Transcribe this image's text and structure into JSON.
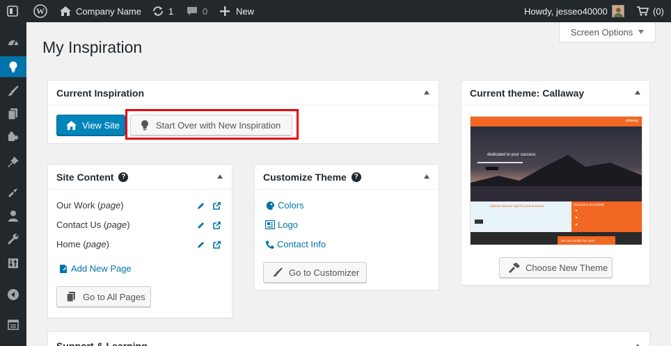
{
  "adminbar": {
    "site_name": "Company Name",
    "updates_count": "1",
    "comments_count": "0",
    "new_label": "New",
    "howdy": "Howdy, jesseo40000",
    "cart_count": "(0)"
  },
  "screen_options": "Screen Options",
  "page_title": "My Inspiration",
  "current_inspiration": {
    "title": "Current Inspiration",
    "view_site": "View Site",
    "start_over": "Start Over with New Inspiration"
  },
  "site_content": {
    "title": "Site Content",
    "help": "?",
    "items": [
      {
        "name": "Our Work",
        "type": "page"
      },
      {
        "name": "Contact Us",
        "type": "page"
      },
      {
        "name": "Home",
        "type": "page"
      }
    ],
    "open_paren": "(",
    "close_paren": ")",
    "add_new": "Add New Page",
    "go_all": "Go to All Pages"
  },
  "customize_theme": {
    "title": "Customize Theme",
    "help": "?",
    "links": [
      "Colors",
      "Logo",
      "Contact Info"
    ],
    "go_customizer": "Go to Customizer"
  },
  "current_theme": {
    "title": "Current theme: Callaway",
    "choose": "Choose New Theme",
    "preview": {
      "brand": "callaway",
      "hero_text": "dedicated to your success",
      "left_heading": "Options that are right for your business",
      "right_heading": "Success is our priority",
      "footer_text": "We can handle the work"
    }
  },
  "support": {
    "title": "Support & Learning"
  },
  "colors": {
    "adminbar": "#23282d",
    "accent": "#0073aa",
    "primary_button": "#0085ba",
    "highlight": "#e8000b",
    "theme_orange": "#f26722"
  }
}
